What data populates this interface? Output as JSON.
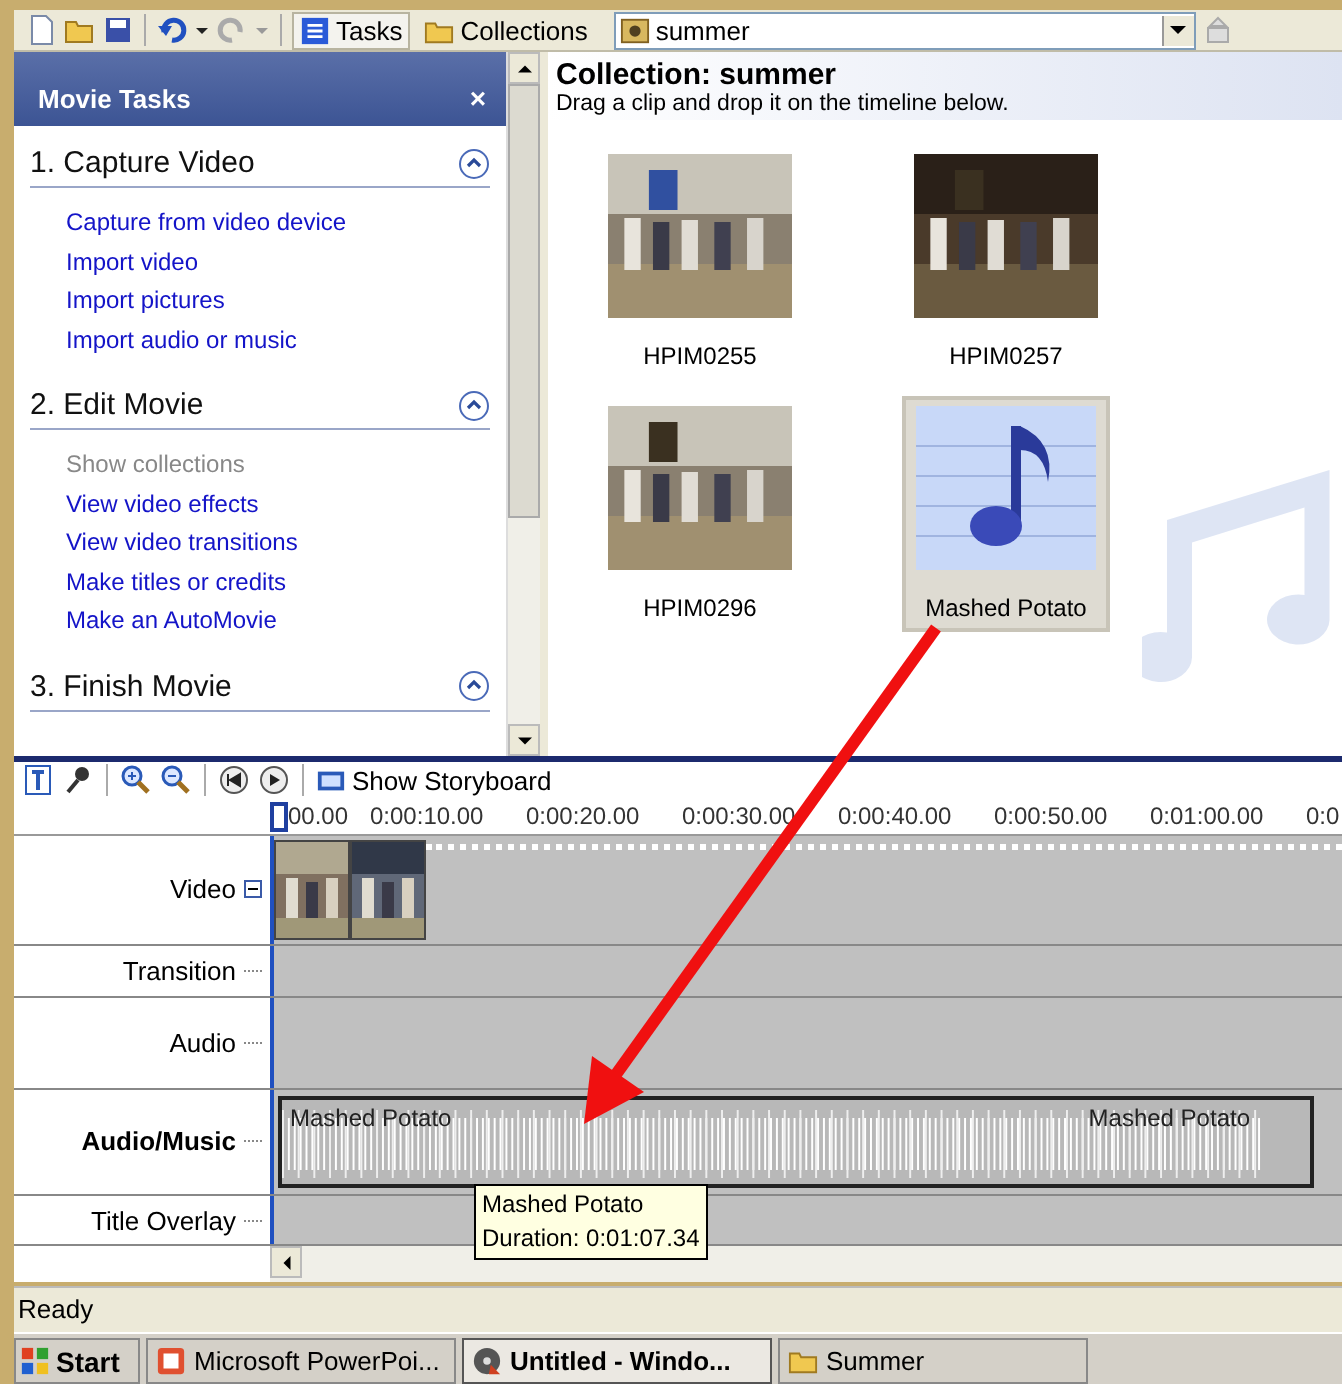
{
  "toolbar": {
    "tabs": [
      {
        "label": "Tasks",
        "selected": true
      },
      {
        "label": "Collections",
        "selected": false
      }
    ],
    "collection_select": {
      "value": "summer"
    }
  },
  "task_pane": {
    "title": "Movie Tasks",
    "close": "×",
    "sections": [
      {
        "title": "1. Capture Video",
        "expanded": true,
        "links": [
          {
            "label": "Capture from video device",
            "disabled": false
          },
          {
            "label": "Import video",
            "disabled": false
          },
          {
            "label": "Import pictures",
            "disabled": false
          },
          {
            "label": "Import audio or music",
            "disabled": false
          }
        ]
      },
      {
        "title": "2. Edit Movie",
        "expanded": true,
        "links": [
          {
            "label": "Show collections",
            "disabled": true
          },
          {
            "label": "View video effects",
            "disabled": false
          },
          {
            "label": "View video transitions",
            "disabled": false
          },
          {
            "label": "Make titles or credits",
            "disabled": false
          },
          {
            "label": "Make an AutoMovie",
            "disabled": false
          }
        ]
      },
      {
        "title": "3. Finish Movie",
        "expanded": true
      }
    ]
  },
  "collection": {
    "title": "Collection: summer",
    "hint": "Drag a clip and drop it on the timeline below.",
    "clips": [
      {
        "name": "HPIM0255",
        "kind": "video",
        "selected": false
      },
      {
        "name": "HPIM0257",
        "kind": "video",
        "selected": false
      },
      {
        "name": "HPIM0296",
        "kind": "video",
        "selected": false
      },
      {
        "name": "Mashed Potato",
        "kind": "audio",
        "selected": true
      }
    ]
  },
  "timeline": {
    "storyboard_button": "Show Storyboard",
    "ruler": [
      "00.00",
      "0:00:10.00",
      "0:00:20.00",
      "0:00:30.00",
      "0:00:40.00",
      "0:00:50.00",
      "0:01:00.00",
      "0:0"
    ],
    "tracks": [
      {
        "label": "Video",
        "kind": "video",
        "selected": false
      },
      {
        "label": "Transition",
        "kind": "transition",
        "selected": false
      },
      {
        "label": "Audio",
        "kind": "audio",
        "selected": false
      },
      {
        "label": "Audio/Music",
        "kind": "music",
        "selected": true,
        "clip_labels": [
          "Mashed Potato",
          "Mashed Potato"
        ]
      },
      {
        "label": "Title Overlay",
        "kind": "title",
        "selected": false
      }
    ],
    "tooltip": {
      "title": "Mashed Potato",
      "detail": "Duration:  0:01:07.34"
    }
  },
  "status_bar": "Ready",
  "taskbar": {
    "start": "Start",
    "items": [
      {
        "label": "Microsoft PowerPoi...",
        "kind": "slides",
        "selected": false
      },
      {
        "label": "Untitled - Windo...",
        "kind": "film",
        "selected": true
      },
      {
        "label": "Summer",
        "kind": "folder",
        "selected": false
      }
    ]
  }
}
